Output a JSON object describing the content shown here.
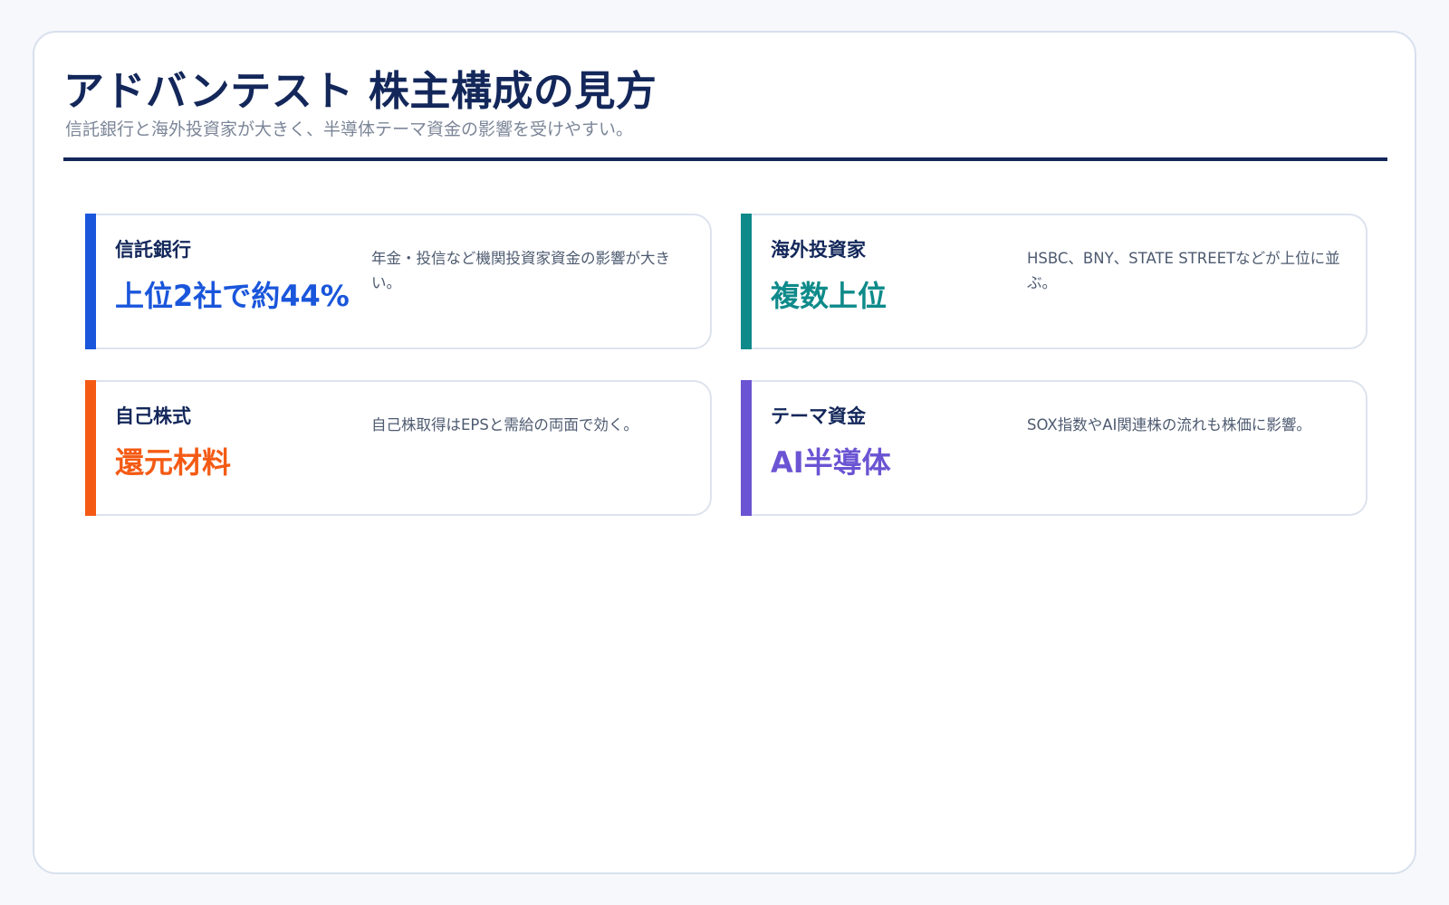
{
  "header": {
    "title": "アドバンテスト 株主構成の見方",
    "subtitle": "信託銀行と海外投資家が大きく、半導体テーマ資金の影響を受けやすい。"
  },
  "cards": [
    {
      "label": "信託銀行",
      "value": "上位2社で約44%",
      "note": "年金・投信など機関投資家資金の影響が大きい。",
      "accent": "#1a56db"
    },
    {
      "label": "海外投資家",
      "value": "複数上位",
      "note": "HSBC、BNY、STATE STREETなどが上位に並ぶ。",
      "accent": "#0e8a8a"
    },
    {
      "label": "自己株式",
      "value": "還元材料",
      "note": "自己株取得はEPSと需給の両面で効く。",
      "accent": "#f45a14"
    },
    {
      "label": "テーマ資金",
      "value": "AI半導体",
      "note": "SOX指数やAI関連株の流れも株価に影響。",
      "accent": "#6b54d3"
    }
  ],
  "colors": {
    "title": "#13275a",
    "subtitle": "#7c8698",
    "rule": "#13275a",
    "card_border": "#dde3ee",
    "background": "#f6f8fb"
  }
}
